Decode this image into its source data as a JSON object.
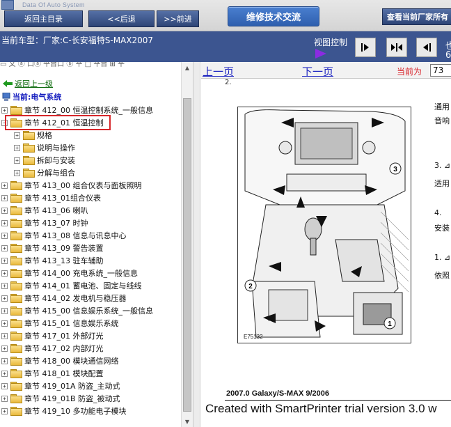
{
  "app": {
    "subtitle": "Data Of Auto System"
  },
  "toolbar": {
    "home_label": "返回主目录",
    "back_label": "<<后退",
    "forward_label": ">>前进",
    "forum_label": "维修技术交流",
    "view_current_label": "查看当前厂家所有"
  },
  "infobar": {
    "current_model": "当前车型：厂家:C-长安福特S-MAX2007",
    "view_control_label": "视图控制",
    "extra_glyph_1": "也",
    "extra_glyph_2": "6"
  },
  "tree": {
    "header": "▭ 文 ⓐ 口ⓐ 平台口 ⓑ 平 □ 平台 ⊞ 平",
    "back_label": "返回上一级",
    "current_label": "当前:电气系统",
    "items": [
      {
        "label": "章节 412_00 恒温控制系统_一般信息",
        "level": 0,
        "expander": "+"
      },
      {
        "label": "章节 412_01 恒温控制",
        "level": 0,
        "expander": "−"
      },
      {
        "label": "规格",
        "level": 1,
        "expander": "+"
      },
      {
        "label": "说明与操作",
        "level": 1,
        "expander": "+"
      },
      {
        "label": "拆卸与安装",
        "level": 1,
        "expander": "+"
      },
      {
        "label": "分解与组合",
        "level": 1,
        "expander": "+"
      },
      {
        "label": "章节 413_00 组合仪表与面板照明",
        "level": 0,
        "expander": "+"
      },
      {
        "label": "章节 413_01组合仪表",
        "level": 0,
        "expander": "+"
      },
      {
        "label": "章节 413_06 喇叭",
        "level": 0,
        "expander": "+"
      },
      {
        "label": "章节 413_07 时钟",
        "level": 0,
        "expander": "+"
      },
      {
        "label": "章节 413_08 信息与讯息中心",
        "level": 0,
        "expander": "+"
      },
      {
        "label": "章节 413_09 警告装置",
        "level": 0,
        "expander": "+"
      },
      {
        "label": "章节 413_13 驻车辅助",
        "level": 0,
        "expander": "+"
      },
      {
        "label": "章节 414_00 充电系统_一般信息",
        "level": 0,
        "expander": "+"
      },
      {
        "label": "章节 414_01 蓄电池、固定与线线",
        "level": 0,
        "expander": "+"
      },
      {
        "label": "章节 414_02 发电机与稳压器",
        "level": 0,
        "expander": "+"
      },
      {
        "label": "章节 415_00 信息娱乐系统_一般信息",
        "level": 0,
        "expander": "+"
      },
      {
        "label": "章节 415_01 信息娱乐系统",
        "level": 0,
        "expander": "+"
      },
      {
        "label": "章节 417_01 外部灯光",
        "level": 0,
        "expander": "+"
      },
      {
        "label": "章节 417_02 内部灯光",
        "level": 0,
        "expander": "+"
      },
      {
        "label": "章节 418_00 模块通信网络",
        "level": 0,
        "expander": "+"
      },
      {
        "label": "章节 418_01 模块配置",
        "level": 0,
        "expander": "+"
      },
      {
        "label": "章节 419_01A 防盗_主动式",
        "level": 0,
        "expander": "+"
      },
      {
        "label": "章节 419_01B 防盗_被动式",
        "level": 0,
        "expander": "+"
      },
      {
        "label": "章节 419_10 多功能电子模块",
        "level": 0,
        "expander": "+"
      }
    ]
  },
  "pager": {
    "prev_label": "上一页",
    "next_label": "下一页",
    "current_page_label": "当前为",
    "current_page_value": "73"
  },
  "document": {
    "step_2": "2.",
    "figure_id": "E75132",
    "callouts": [
      "1",
      "2",
      "3"
    ],
    "right_lines": [
      "通用",
      "音响",
      "3. ⊿",
      "适用",
      "4.",
      "安装",
      "1. ⊿",
      "依照"
    ],
    "footer_title": "2007.0 Galaxy/S-MAX 9/2006",
    "watermark": "Created with SmartPrinter trial version 3.0  w"
  },
  "colors": {
    "toolbar_blue": "#3c5590",
    "highlight_red": "#d6262a",
    "link_blue": "#1a22c0",
    "back_link_green": "#0b6a0b",
    "folder_yellow": "#f1c848"
  }
}
